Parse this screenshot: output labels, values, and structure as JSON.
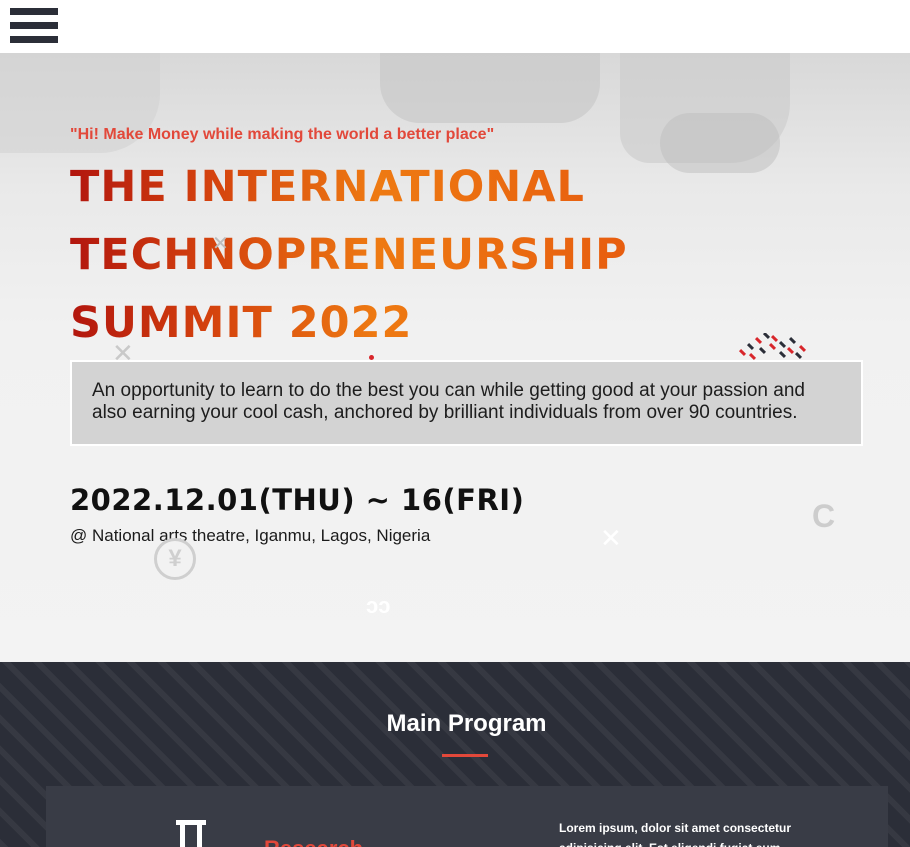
{
  "header": {
    "menu_icon": "hamburger-menu-icon"
  },
  "hero": {
    "tagline": "\"Hi! Make Money while making the world a better place\"",
    "title_lines": [
      "THE INTERNATIONAL",
      "TECHNOPRENEURSHIP",
      "SUMMIT 2022"
    ],
    "description": "An opportunity to learn to do the best you can while getting good at your passion and also earning your cool cash, anchored by brilliant individuals from over 90 countries.",
    "date": "2022.12.01(THU) ~ 16(FRI)",
    "venue": "@ National arts theatre, Iganmu, Lagos, Nigeria",
    "colors": {
      "accent": "#e2483a",
      "title_start": "#b2160e",
      "title_end": "#ee7a12"
    }
  },
  "program": {
    "heading": "Main Program",
    "card": {
      "icon": "pillar-icon",
      "title": "Research",
      "text": "Lorem ipsum, dolor sit amet consectetur adipisicing elit. Est eligendi fugiat eum"
    },
    "colors": {
      "background": "#2b2e38",
      "card": "#393c46"
    }
  }
}
